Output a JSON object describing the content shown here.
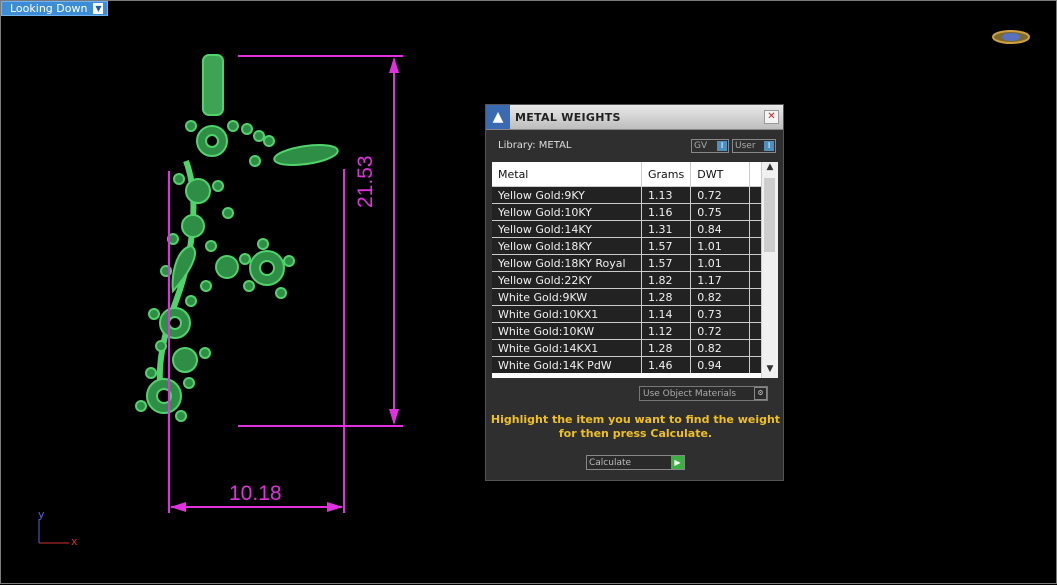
{
  "viewport": {
    "label": "Looking Down",
    "dimension_height": "21.53",
    "dimension_width": "10.18",
    "axis_x": "x",
    "axis_y": "y"
  },
  "panel": {
    "title": "METAL WEIGHTS",
    "library_label": "Library: METAL",
    "gv_label": "GV",
    "user_label": "User",
    "columns": [
      "Metal",
      "Grams",
      "DWT"
    ],
    "rows": [
      {
        "metal": "Yellow Gold:9KY",
        "grams": "1.13",
        "dwt": "0.72"
      },
      {
        "metal": "Yellow Gold:10KY",
        "grams": "1.16",
        "dwt": "0.75"
      },
      {
        "metal": "Yellow Gold:14KY",
        "grams": "1.31",
        "dwt": "0.84"
      },
      {
        "metal": "Yellow Gold:18KY",
        "grams": "1.57",
        "dwt": "1.01"
      },
      {
        "metal": "Yellow Gold:18KY Royal",
        "grams": "1.57",
        "dwt": "1.01"
      },
      {
        "metal": "Yellow Gold:22KY",
        "grams": "1.82",
        "dwt": "1.17"
      },
      {
        "metal": "White Gold:9KW",
        "grams": "1.28",
        "dwt": "0.82"
      },
      {
        "metal": "White Gold:10KX1",
        "grams": "1.14",
        "dwt": "0.73"
      },
      {
        "metal": "White Gold:10KW",
        "grams": "1.12",
        "dwt": "0.72"
      },
      {
        "metal": "White Gold:14KX1",
        "grams": "1.28",
        "dwt": "0.82"
      },
      {
        "metal": "White Gold:14K PdW",
        "grams": "1.46",
        "dwt": "0.94"
      }
    ],
    "use_object_materials": "Use Object Materials",
    "message": "Highlight the item you want to find the weight for then press Calculate.",
    "calculate_label": "Calculate"
  },
  "colors": {
    "model": "#4fd36a",
    "dimension": "#e030e0",
    "message": "#f0c020"
  }
}
